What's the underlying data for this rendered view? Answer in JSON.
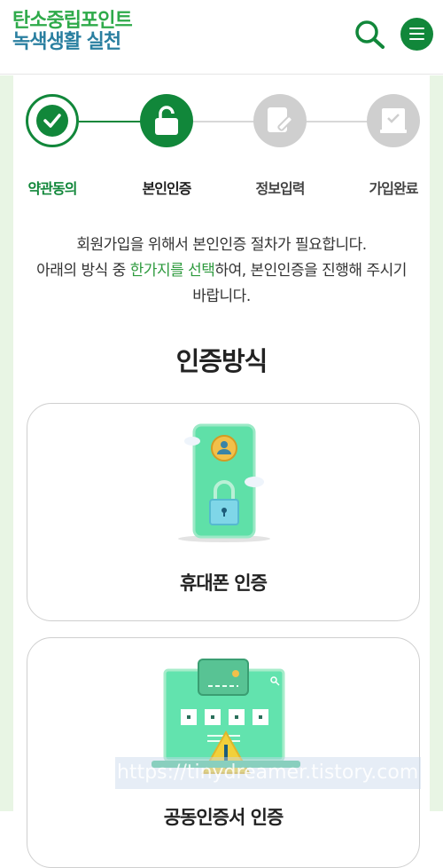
{
  "header": {
    "logo_line1": "탄소중립포인트",
    "logo_line2": "녹색생활 실천",
    "search_icon": "search-icon",
    "menu_icon": "hamburger-menu-icon"
  },
  "steps": [
    {
      "label": "약관동의",
      "state": "done",
      "icon": "check-icon"
    },
    {
      "label": "본인인증",
      "state": "current",
      "icon": "unlock-icon"
    },
    {
      "label": "정보입력",
      "state": "pending",
      "icon": "edit-icon"
    },
    {
      "label": "가입완료",
      "state": "pending",
      "icon": "document-check-icon"
    }
  ],
  "intro": {
    "line1": "회원가입을 위해서 본인인증 절차가 필요합니다.",
    "line2_before": "아래의 방식 중 ",
    "line2_highlight": "한가지를 선택",
    "line2_after": "하여, 본인인증을 진행해 주시기",
    "line3": "바랍니다."
  },
  "section_title": "인증방식",
  "methods": [
    {
      "title": "휴대폰 인증",
      "icon": "mobile-phone-lock-icon"
    },
    {
      "title": "공동인증서 인증",
      "icon": "certificate-laptop-icon"
    }
  ],
  "watermark": "https://tinydreamer.tistory.com",
  "colors": {
    "brand_green": "#11873a",
    "logo_green": "#2eaa4a",
    "logo_blue": "#2a7fa0",
    "highlight": "#2e9a3e",
    "pending_gray": "#cfcfcf",
    "side_band": "#e8f5e4",
    "illustration_mint": "#5fe0a8"
  }
}
